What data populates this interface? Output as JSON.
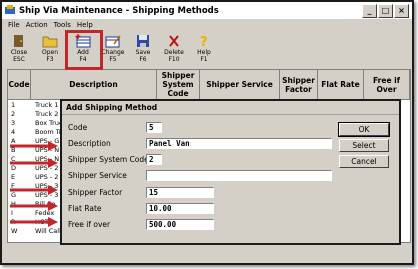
{
  "window": {
    "title": "Ship Via Maintenance - Shipping Methods"
  },
  "menu": [
    "File",
    "Action",
    "Tools",
    "Help"
  ],
  "toolbar": [
    {
      "label": "Close",
      "key": "ESC",
      "icon": "door-icon"
    },
    {
      "label": "Open",
      "key": "F3",
      "icon": "folder-icon"
    },
    {
      "label": "Add",
      "key": "F4",
      "icon": "add-record-icon"
    },
    {
      "label": "Change",
      "key": "F5",
      "icon": "change-icon"
    },
    {
      "label": "Save",
      "key": "F6",
      "icon": "floppy-icon"
    },
    {
      "label": "Delete",
      "key": "F10",
      "icon": "delete-x-icon"
    },
    {
      "label": "Help",
      "key": "F1",
      "icon": "question-icon"
    }
  ],
  "grid": {
    "headers": [
      "Code",
      "Description",
      "Shipper System Code",
      "Shipper Service",
      "Shipper Factor",
      "Flat Rate",
      "Free if Over"
    ],
    "rows": [
      {
        "code": "1",
        "desc": "Truck 1"
      },
      {
        "code": "2",
        "desc": "Truck 2"
      },
      {
        "code": "3",
        "desc": "Box Truck"
      },
      {
        "code": "4",
        "desc": "Boom Tr"
      },
      {
        "code": "A",
        "desc": "UPS - G"
      },
      {
        "code": "B",
        "desc": "UPS - N"
      },
      {
        "code": "C",
        "desc": "UPS - N"
      },
      {
        "code": "D",
        "desc": "UPS - 2"
      },
      {
        "code": "E",
        "desc": "UPS - 2"
      },
      {
        "code": "F",
        "desc": "UPS - 3"
      },
      {
        "code": "G",
        "desc": "UPS - 3"
      },
      {
        "code": "H",
        "desc": "Bill Co"
      },
      {
        "code": "I",
        "desc": "Fedex"
      },
      {
        "code": "R",
        "desc": "HOT"
      },
      {
        "code": "W",
        "desc": "Will Call"
      }
    ]
  },
  "dialog": {
    "title": "Add Shipping Method",
    "fields": [
      {
        "label": "Code",
        "value": "5"
      },
      {
        "label": "Description",
        "value": "Panel Van"
      },
      {
        "label": "Shipper System Code",
        "value": "2"
      },
      {
        "label": "Shipper Service",
        "value": ""
      },
      {
        "label": "Shipper Factor",
        "value": "15"
      },
      {
        "label": "Flat Rate",
        "value": "10.00"
      },
      {
        "label": "Free if over",
        "value": "500.00"
      }
    ],
    "buttons": [
      "OK",
      "Select",
      "Cancel"
    ]
  },
  "colors": {
    "highlight": "#c0262a",
    "arrow": "#c0262a"
  }
}
